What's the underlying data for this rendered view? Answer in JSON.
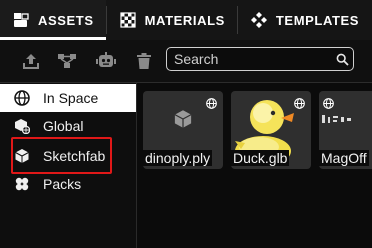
{
  "tabs": [
    {
      "label": "ASSETS",
      "icon": "asset-box-icon",
      "active": true
    },
    {
      "label": "MATERIALS",
      "icon": "checker-icon",
      "active": false
    },
    {
      "label": "TEMPLATES",
      "icon": "diamond-grid-icon",
      "active": false
    }
  ],
  "toolbar": {
    "buttons": [
      "upload-icon",
      "node-graph-icon",
      "robot-icon",
      "trash-icon"
    ],
    "search": {
      "placeholder": "Search",
      "value": ""
    }
  },
  "sidebar": {
    "items": [
      {
        "label": "In Space",
        "icon": "globe-icon",
        "active": true
      },
      {
        "label": "Global",
        "icon": "cube-globe-icon",
        "active": false
      },
      {
        "label": "Sketchfab",
        "icon": "sketchfab-icon",
        "active": false
      },
      {
        "label": "Packs",
        "icon": "packs-icon",
        "active": false
      }
    ]
  },
  "assets": [
    {
      "label": "dinoply.ply",
      "thumbnail": "placeholder-cube-icon"
    },
    {
      "label": "Duck.glb",
      "thumbnail": "rubber-duck-image"
    },
    {
      "label": "MagOff",
      "thumbnail": "magoff-image"
    }
  ],
  "colors": {
    "background": "#111111",
    "active_sidebar": "#ffffff",
    "highlight": "#e01818",
    "card": "#2f2f2f",
    "duck": "#f5e35a"
  }
}
